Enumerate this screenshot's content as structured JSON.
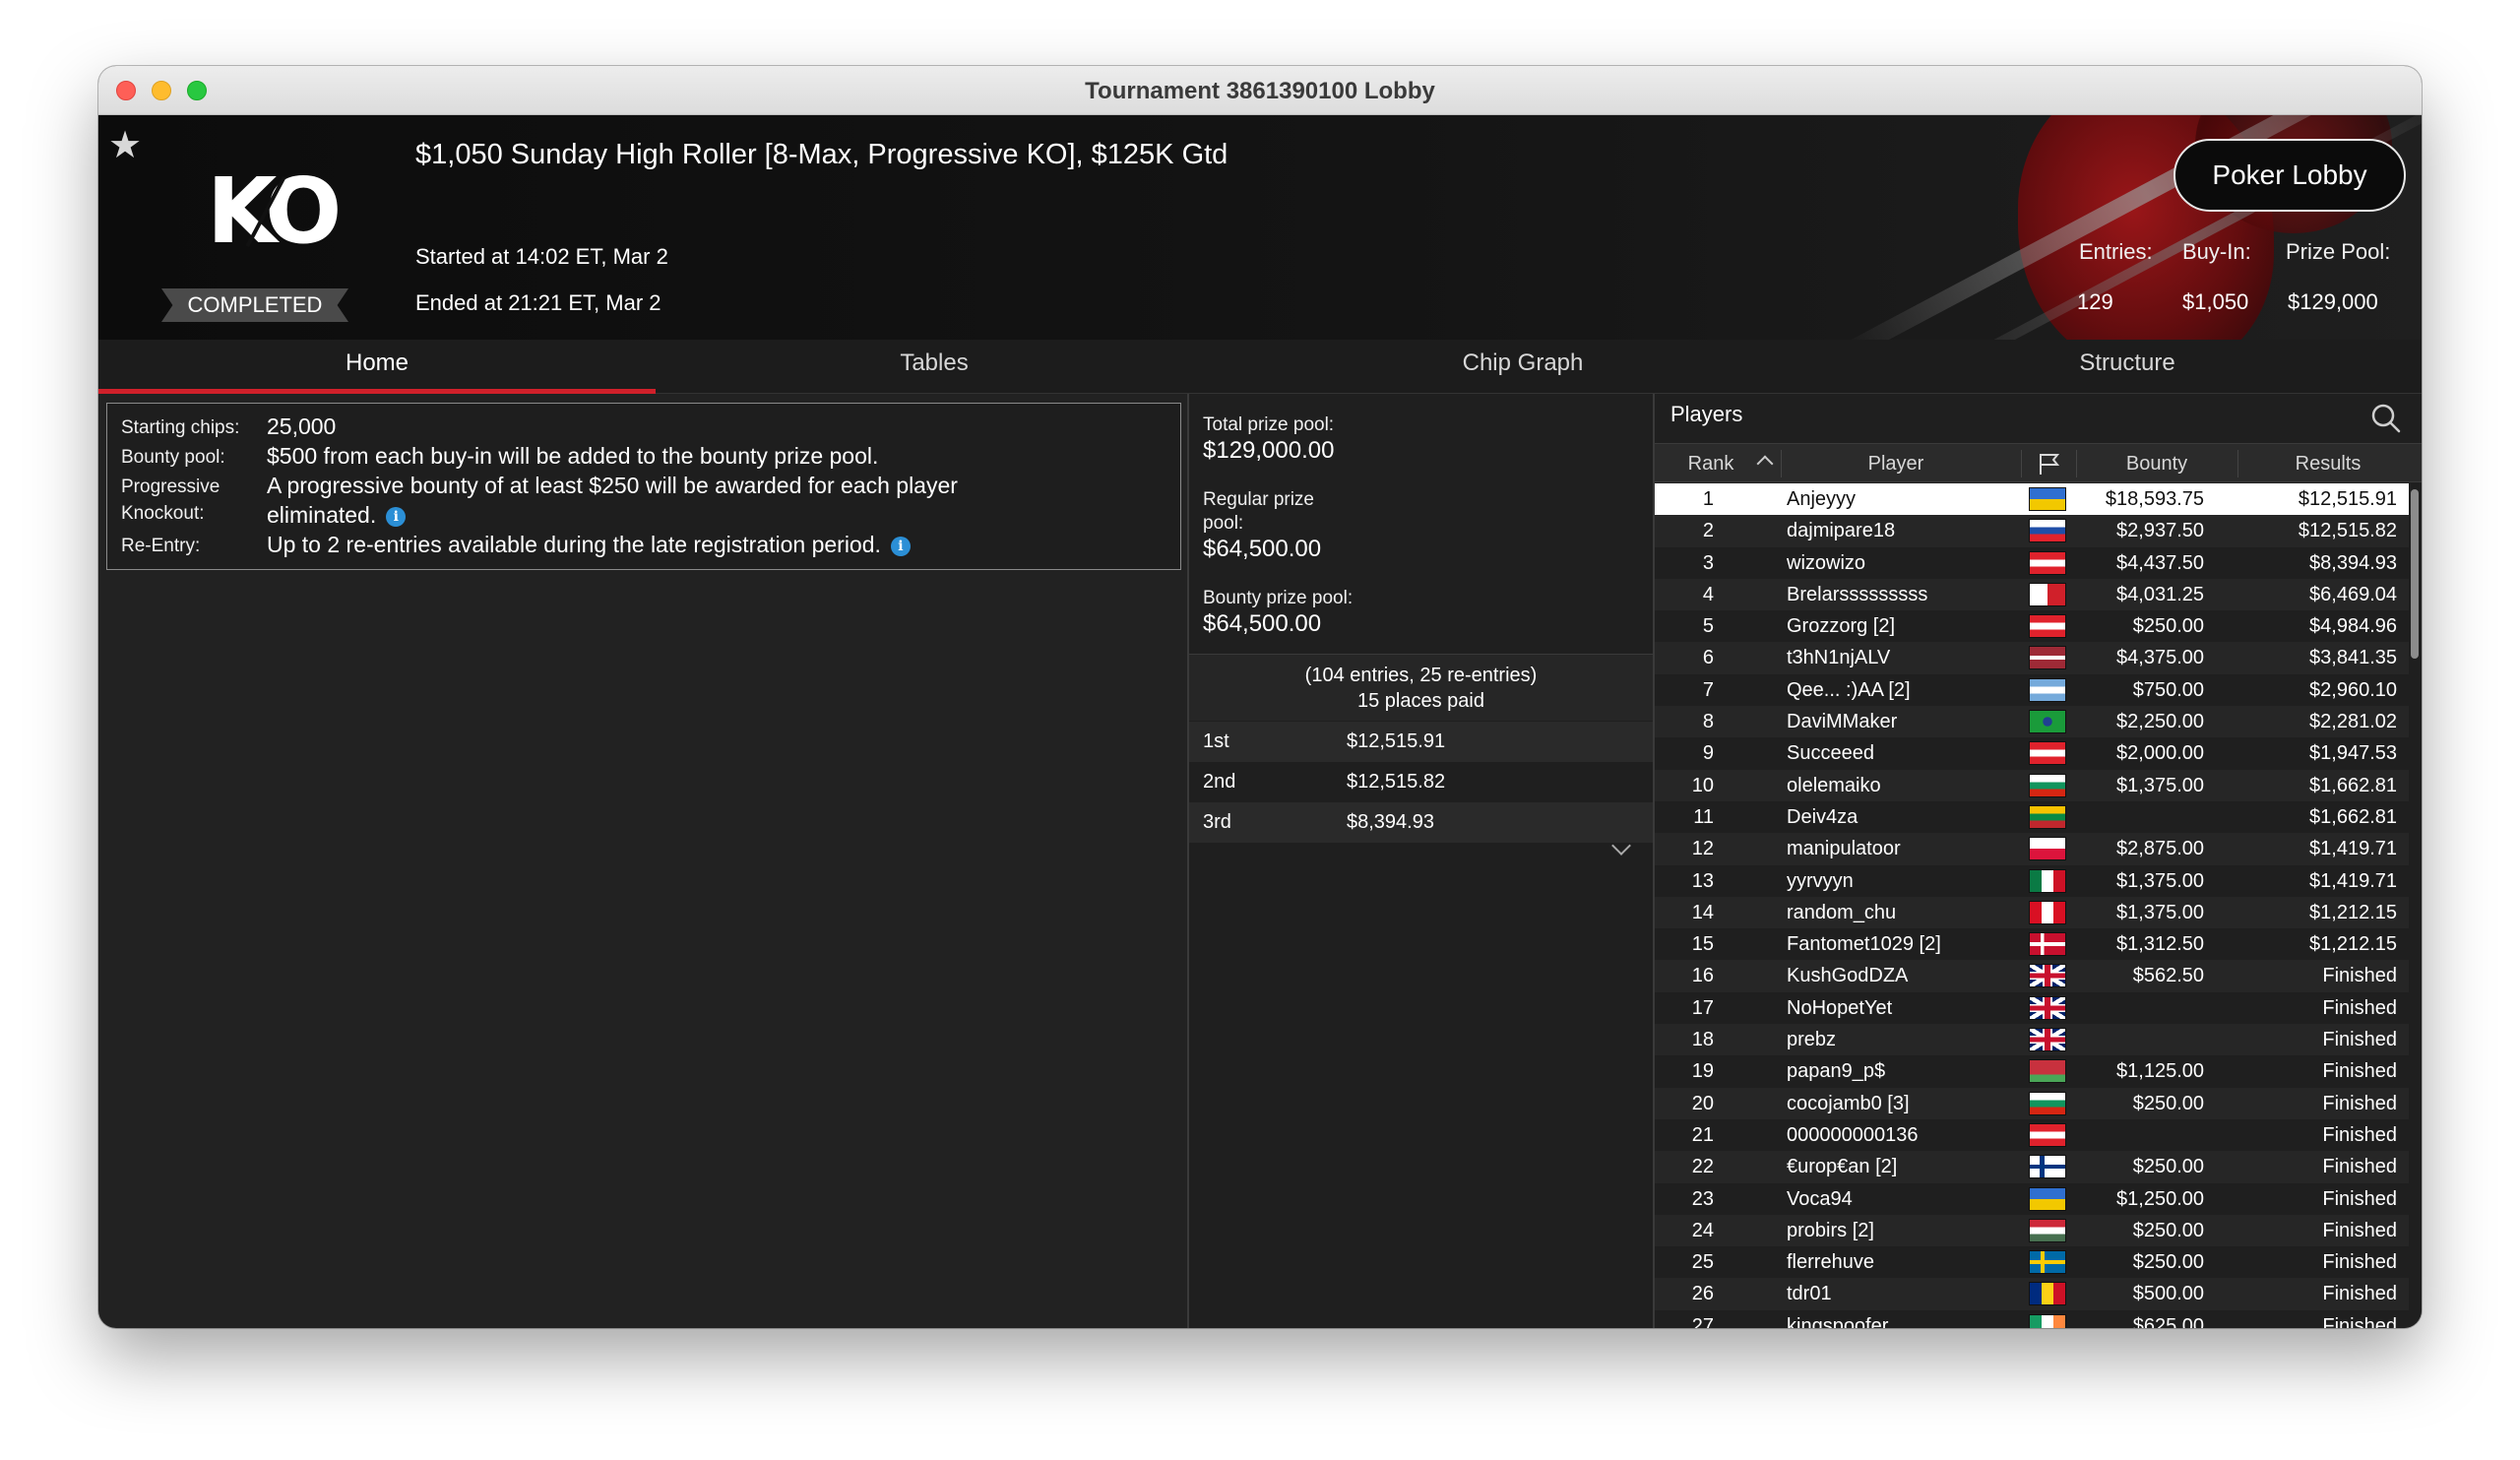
{
  "window": {
    "title": "Tournament 3861390100 Lobby"
  },
  "header": {
    "logo_text": "KO",
    "status": "COMPLETED",
    "tournament_name": "$1,050 Sunday High Roller [8-Max, Progressive KO], $125K Gtd",
    "started": "Started at 14:02 ET, Mar 2",
    "ended": "Ended at 21:21 ET, Mar 2",
    "poker_lobby_label": "Poker Lobby",
    "entries_label": "Entries:",
    "entries_value": "129",
    "buyin_label": "Buy-In:",
    "buyin_value": "$1,050",
    "prizepool_label": "Prize Pool:",
    "prizepool_value": "$129,000"
  },
  "tabs": [
    {
      "label": "Home",
      "active": true
    },
    {
      "label": "Tables",
      "active": false
    },
    {
      "label": "Chip Graph",
      "active": false
    },
    {
      "label": "Structure",
      "active": false
    }
  ],
  "info": {
    "starting_chips_label": "Starting chips:",
    "starting_chips_value": "25,000",
    "bounty_pool_label": "Bounty pool:",
    "bounty_pool_value": "$500 from each buy-in will be added to the bounty prize pool.",
    "progressive_label_1": "Progressive",
    "progressive_label_2": "Knockout:",
    "progressive_value_1": "A progressive bounty of at least $250 will be awarded for each player",
    "progressive_value_2": "eliminated.",
    "reentry_label": "Re-Entry:",
    "reentry_value": "Up to 2 re-entries available during the late registration period."
  },
  "prize": {
    "total_label": "Total prize pool:",
    "total_value": "$129,000.00",
    "regular_label_1": "Regular prize",
    "regular_label_2": "pool:",
    "regular_value": "$64,500.00",
    "bounty_label": "Bounty prize pool:",
    "bounty_value": "$64,500.00",
    "summary_1": "(104 entries, 25 re-entries)",
    "summary_2": "15 places paid",
    "payouts": [
      {
        "place": "1st",
        "amount": "$12,515.91"
      },
      {
        "place": "2nd",
        "amount": "$12,515.82"
      },
      {
        "place": "3rd",
        "amount": "$8,394.93"
      }
    ]
  },
  "players": {
    "title": "Players",
    "columns": {
      "rank": "Rank",
      "player": "Player",
      "bounty": "Bounty",
      "results": "Results"
    },
    "rows": [
      {
        "rank": "1",
        "name": "Anjeyyy",
        "flag": "ua",
        "bounty": "$18,593.75",
        "result": "$12,515.91",
        "selected": true
      },
      {
        "rank": "2",
        "name": "dajmipare18",
        "flag": "si",
        "bounty": "$2,937.50",
        "result": "$12,515.82"
      },
      {
        "rank": "3",
        "name": "wizowizo",
        "flag": "at",
        "bounty": "$4,437.50",
        "result": "$8,394.93"
      },
      {
        "rank": "4",
        "name": "Brelarsssssssss",
        "flag": "mt",
        "bounty": "$4,031.25",
        "result": "$6,469.04"
      },
      {
        "rank": "5",
        "name": "Grozzorg [2]",
        "flag": "at",
        "bounty": "$250.00",
        "result": "$4,984.96"
      },
      {
        "rank": "6",
        "name": "t3hN1njALV",
        "flag": "lv",
        "bounty": "$4,375.00",
        "result": "$3,841.35"
      },
      {
        "rank": "7",
        "name": "Qee... :)AA [2]",
        "flag": "ar",
        "bounty": "$750.00",
        "result": "$2,960.10"
      },
      {
        "rank": "8",
        "name": "DaviMMaker",
        "flag": "br",
        "bounty": "$2,250.00",
        "result": "$2,281.02"
      },
      {
        "rank": "9",
        "name": "Succeeed",
        "flag": "at",
        "bounty": "$2,000.00",
        "result": "$1,947.53"
      },
      {
        "rank": "10",
        "name": "olelemaiko",
        "flag": "bg",
        "bounty": "$1,375.00",
        "result": "$1,662.81"
      },
      {
        "rank": "11",
        "name": "Deiv4za",
        "flag": "lt",
        "bounty": "",
        "result": "$1,662.81"
      },
      {
        "rank": "12",
        "name": "manipulatoor",
        "flag": "pl",
        "bounty": "$2,875.00",
        "result": "$1,419.71"
      },
      {
        "rank": "13",
        "name": "yyrvyyn",
        "flag": "mx",
        "bounty": "$1,375.00",
        "result": "$1,419.71"
      },
      {
        "rank": "14",
        "name": "random_chu",
        "flag": "pe",
        "bounty": "$1,375.00",
        "result": "$1,212.15"
      },
      {
        "rank": "15",
        "name": "Fantomet1029 [2]",
        "flag": "dk",
        "bounty": "$1,312.50",
        "result": "$1,212.15"
      },
      {
        "rank": "16",
        "name": "KushGodDZA",
        "flag": "gb",
        "bounty": "$562.50",
        "result": "Finished"
      },
      {
        "rank": "17",
        "name": "NoHopetYet",
        "flag": "gb",
        "bounty": "",
        "result": "Finished"
      },
      {
        "rank": "18",
        "name": "prebz",
        "flag": "gb",
        "bounty": "",
        "result": "Finished"
      },
      {
        "rank": "19",
        "name": "papan9_p$",
        "flag": "by",
        "bounty": "$1,125.00",
        "result": "Finished"
      },
      {
        "rank": "20",
        "name": "cocojamb0 [3]",
        "flag": "bg",
        "bounty": "$250.00",
        "result": "Finished"
      },
      {
        "rank": "21",
        "name": "000000000136",
        "flag": "at",
        "bounty": "",
        "result": "Finished"
      },
      {
        "rank": "22",
        "name": "€urop€an [2]",
        "flag": "fi",
        "bounty": "$250.00",
        "result": "Finished"
      },
      {
        "rank": "23",
        "name": "Voca94",
        "flag": "ua",
        "bounty": "$1,250.00",
        "result": "Finished"
      },
      {
        "rank": "24",
        "name": "probirs [2]",
        "flag": "hu",
        "bounty": "$250.00",
        "result": "Finished"
      },
      {
        "rank": "25",
        "name": "flerrehuve",
        "flag": "se",
        "bounty": "$250.00",
        "result": "Finished"
      },
      {
        "rank": "26",
        "name": "tdr01",
        "flag": "ro",
        "bounty": "$500.00",
        "result": "Finished"
      },
      {
        "rank": "27",
        "name": "kingspoofer",
        "flag": "ie",
        "bounty": "$625.00",
        "result": "Finished"
      }
    ]
  },
  "colors": {
    "accent_red": "#d0202a",
    "info_blue": "#2b8fd6"
  }
}
